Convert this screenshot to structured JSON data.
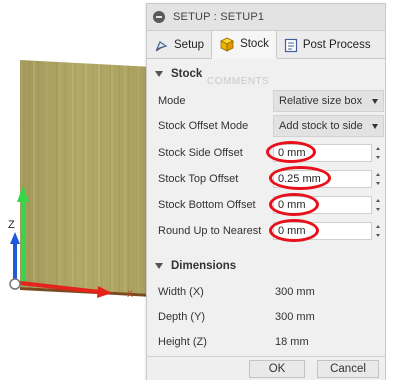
{
  "dialog": {
    "title": "SETUP : SETUP1",
    "tabs": [
      {
        "label": "Setup",
        "icon": "setup-icon"
      },
      {
        "label": "Stock",
        "icon": "stock-cube-icon"
      },
      {
        "label": "Post Process",
        "icon": "post-process-icon"
      }
    ],
    "active_tab": "Stock",
    "stock_section": {
      "title": "Stock",
      "ghost_text": "COMMENTS",
      "mode": {
        "label": "Mode",
        "value": "Relative size box"
      },
      "stock_offset_mode": {
        "label": "Stock Offset Mode",
        "value": "Add stock to side"
      },
      "side_offset": {
        "label": "Stock Side Offset",
        "value": "0 mm"
      },
      "top_offset": {
        "label": "Stock Top Offset",
        "value": "0.25 mm"
      },
      "bottom_offset": {
        "label": "Stock Bottom Offset",
        "value": "0 mm"
      },
      "round_up": {
        "label": "Round Up to Nearest",
        "value": "0 mm"
      }
    },
    "dimensions_section": {
      "title": "Dimensions",
      "width": {
        "label": "Width (X)",
        "value": "300 mm"
      },
      "depth": {
        "label": "Depth (Y)",
        "value": "300 mm"
      },
      "height": {
        "label": "Height (Z)",
        "value": "18 mm"
      }
    },
    "buttons": {
      "ok": "OK",
      "cancel": "Cancel"
    }
  },
  "viewport": {
    "axis_labels": {
      "z": "Z",
      "x": "X"
    },
    "colors": {
      "z_axis": "#1e5bd6",
      "y_axis": "#37d64a",
      "x_axis": "#e3231c",
      "highlight": "#e8101a"
    }
  }
}
